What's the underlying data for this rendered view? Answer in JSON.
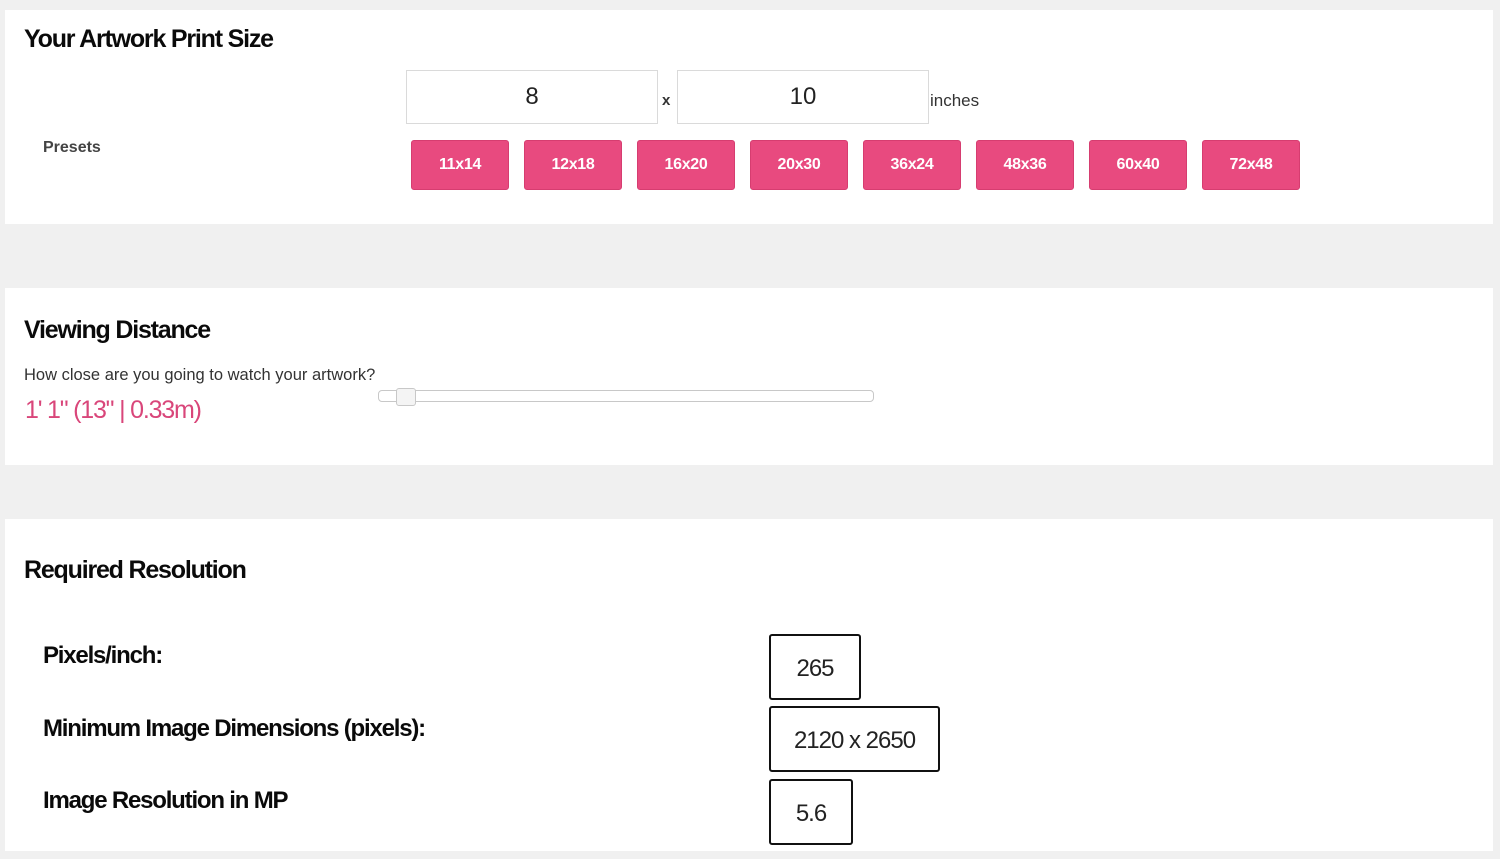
{
  "print_size": {
    "title": "Your Artwork Print Size",
    "width_value": "8",
    "height_value": "10",
    "times_sign": "x",
    "unit": "inches",
    "presets_label": "Presets",
    "presets": [
      "11x14",
      "12x18",
      "16x20",
      "20x30",
      "36x24",
      "48x36",
      "60x40",
      "72x48"
    ]
  },
  "viewing_distance": {
    "title": "Viewing Distance",
    "question": "How close are you going to watch your artwork?",
    "value_display": "1' 1\" (13\" | 0.33m)",
    "slider_position_fraction": 0.03
  },
  "required_resolution": {
    "title": "Required Resolution",
    "rows": [
      {
        "label": "Pixels/inch:",
        "value": "265"
      },
      {
        "label": "Minimum Image Dimensions (pixels):",
        "value": "2120 x 2650"
      },
      {
        "label": "Image Resolution in MP",
        "value": "5.6"
      }
    ]
  },
  "colors": {
    "accent": "#e84a7f",
    "accent_text": "#d9467a",
    "page_background": "#f0f0f0",
    "panel_background": "#ffffff"
  }
}
